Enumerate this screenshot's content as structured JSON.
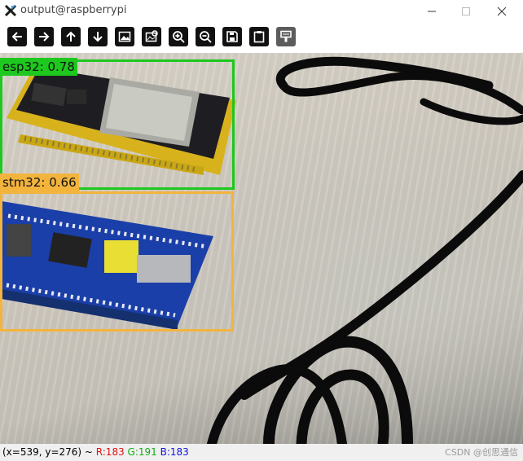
{
  "window": {
    "title": "output@raspberrypi",
    "controls": [
      "minimize-icon",
      "maximize-icon",
      "close-icon"
    ]
  },
  "toolbar": {
    "buttons": [
      {
        "name": "pan-left-button",
        "icon": "arrow-left-icon"
      },
      {
        "name": "pan-right-button",
        "icon": "arrow-right-icon"
      },
      {
        "name": "pan-up-button",
        "icon": "arrow-up-icon"
      },
      {
        "name": "pan-down-button",
        "icon": "arrow-down-icon"
      },
      {
        "name": "zoom-in-image-button",
        "icon": "image-icon"
      },
      {
        "name": "zoom-image-window-button",
        "icon": "image-zoom-icon"
      },
      {
        "name": "zoom-in-button",
        "icon": "zoom-in-icon"
      },
      {
        "name": "zoom-out-button",
        "icon": "zoom-out-icon"
      },
      {
        "name": "save-button",
        "icon": "save-icon"
      },
      {
        "name": "copy-button",
        "icon": "clipboard-icon"
      },
      {
        "name": "properties-button",
        "icon": "brush-icon"
      }
    ]
  },
  "detections": [
    {
      "label": "esp32: 0.78",
      "color": "#1ec81e"
    },
    {
      "label": "stm32: 0.66",
      "color": "#f2b43c"
    }
  ],
  "status": {
    "coords": "(x=539, y=276) ~ ",
    "r": "R:183",
    "g": "G:191",
    "b": "B:183",
    "r_color": "#e01010",
    "g_color": "#10b010",
    "b_color": "#1010e0",
    "watermark": "CSDN @创思通信"
  }
}
